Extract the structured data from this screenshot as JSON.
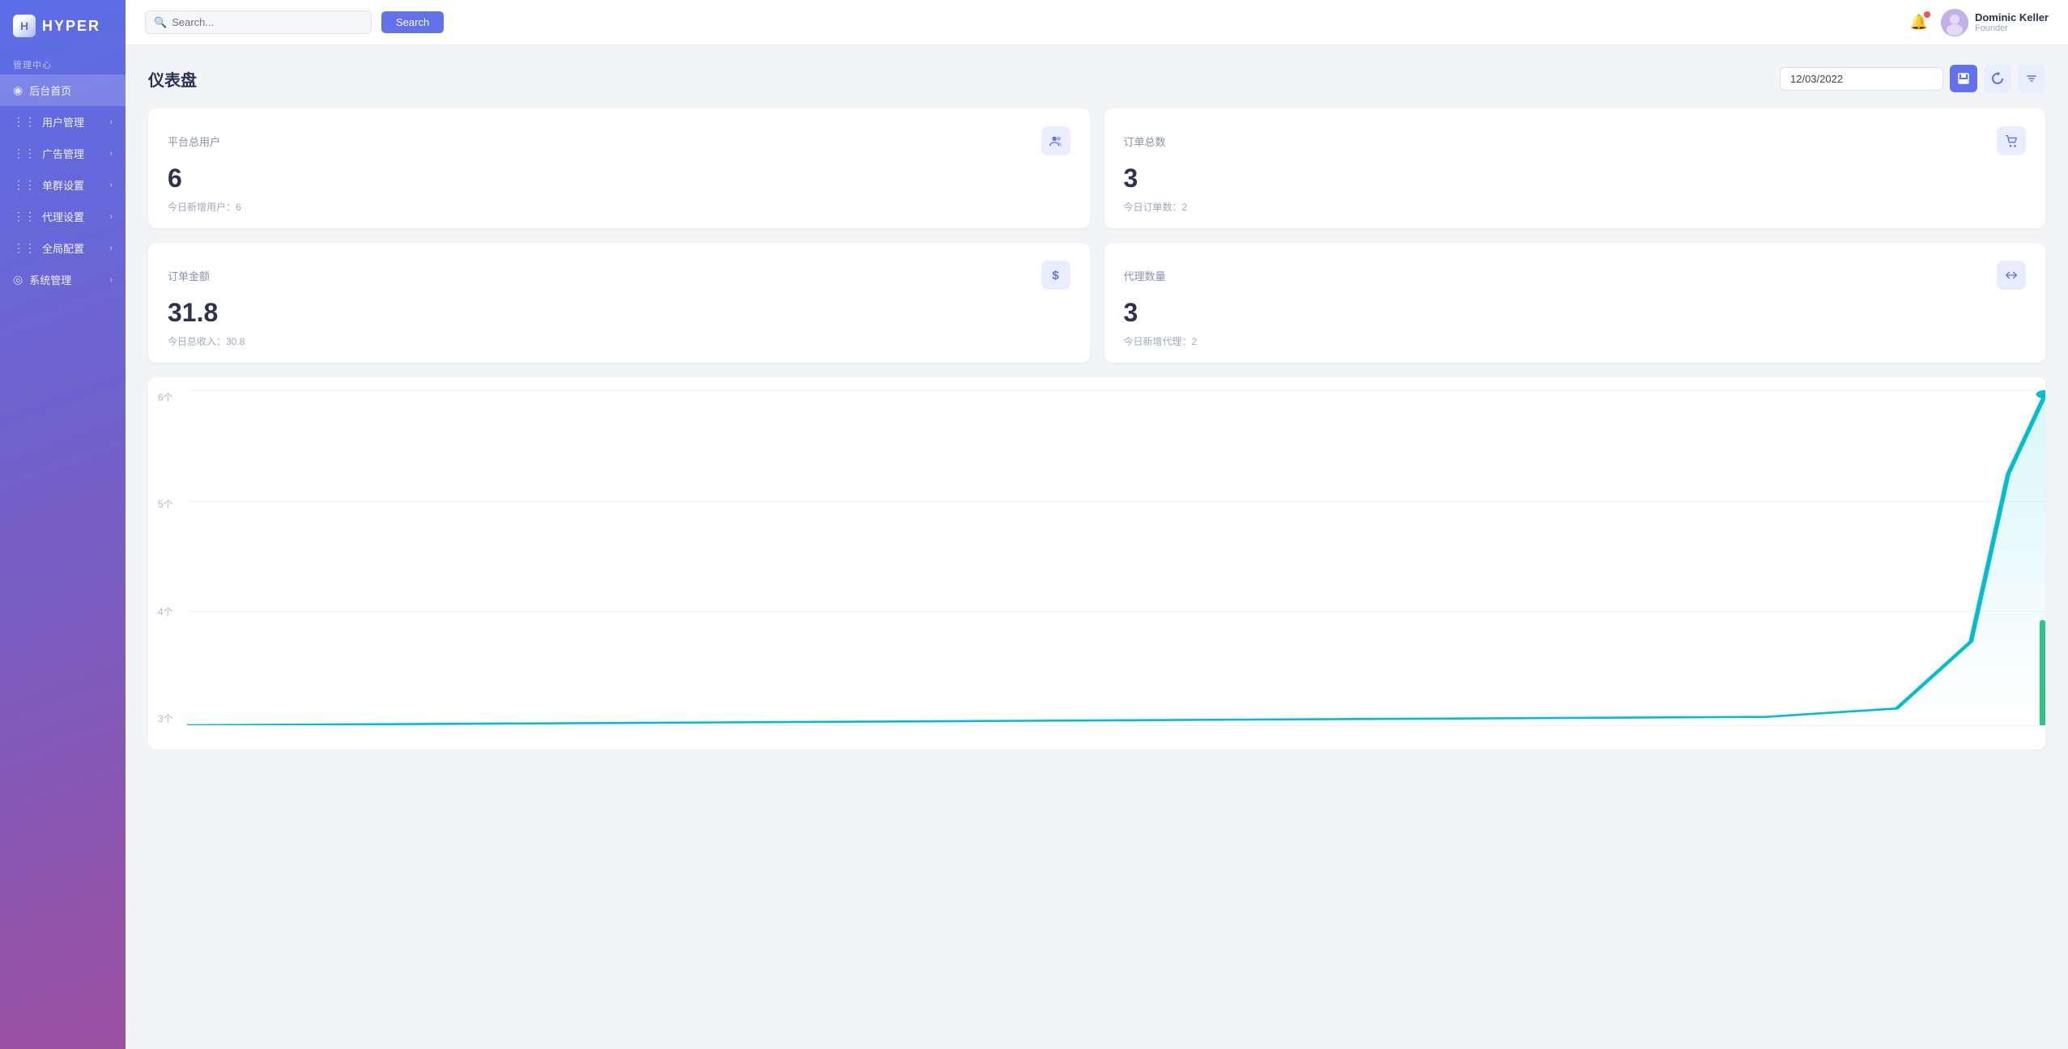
{
  "app": {
    "name": "HYPER"
  },
  "sidebar": {
    "section_label": "管理中心",
    "items": [
      {
        "id": "home",
        "label": "后台首页",
        "icon": "⊙",
        "active": true,
        "has_chevron": false
      },
      {
        "id": "users",
        "label": "用户管理",
        "icon": "☰",
        "active": false,
        "has_chevron": true
      },
      {
        "id": "ads",
        "label": "广告管理",
        "icon": "☰",
        "active": false,
        "has_chevron": true
      },
      {
        "id": "orders",
        "label": "单群设置",
        "icon": "☰",
        "active": false,
        "has_chevron": true
      },
      {
        "id": "agent",
        "label": "代理设置",
        "icon": "☰",
        "active": false,
        "has_chevron": true
      },
      {
        "id": "global",
        "label": "全局配置",
        "icon": "☰",
        "active": false,
        "has_chevron": true
      },
      {
        "id": "system",
        "label": "系统管理",
        "icon": "⊙",
        "active": false,
        "has_chevron": true
      }
    ]
  },
  "topbar": {
    "search_placeholder": "Search...",
    "search_button_label": "Search",
    "user": {
      "name": "Dominic Keller",
      "role": "Founder"
    }
  },
  "page": {
    "title": "仪表盘",
    "date": "12/03/2022"
  },
  "stats": [
    {
      "id": "total-users",
      "title": "平台总用户",
      "value": "6",
      "sub": "今日新增用户：6",
      "icon": "👥",
      "icon_type": "users"
    },
    {
      "id": "total-orders",
      "title": "订单总数",
      "value": "3",
      "sub": "今日订单数：2",
      "icon": "🛒",
      "icon_type": "cart"
    },
    {
      "id": "order-amount",
      "title": "订单金额",
      "value": "31.8",
      "sub": "今日总收入：30.8",
      "icon": "$",
      "icon_type": "dollar"
    },
    {
      "id": "agent-count",
      "title": "代理数量",
      "value": "3",
      "sub": "今日新增代理：2",
      "icon": "↔",
      "icon_type": "arrows"
    }
  ],
  "chart": {
    "y_labels": [
      "6个",
      "5个",
      "4个",
      "3个"
    ],
    "grid_lines": [
      0,
      25,
      50,
      75,
      100
    ]
  },
  "action_buttons": [
    {
      "id": "save",
      "icon": "💾",
      "variant": "blue"
    },
    {
      "id": "refresh",
      "icon": "↻",
      "variant": "light-blue"
    },
    {
      "id": "filter",
      "icon": "▼",
      "variant": "light-blue2"
    }
  ]
}
